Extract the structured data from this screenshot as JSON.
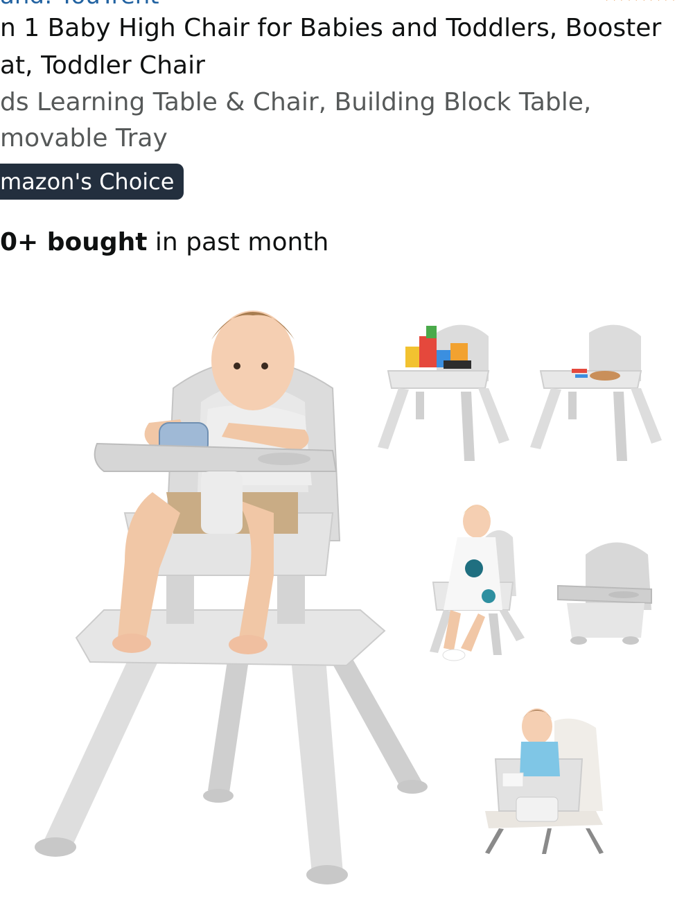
{
  "product": {
    "brand_partial": "and: YouTrent",
    "rating_stars_partial": "★★★★★",
    "title": "n 1 Baby High Chair for Babies and Toddlers, Booster at, Toddler Chair",
    "subtitle": "ds Learning Table & Chair, Building Block Table, movable Tray",
    "badge": "mazon's Choice",
    "bought_count": "0+ bought",
    "bought_suffix": " in past month"
  },
  "image": {
    "icon": "product-photo-high-chair",
    "colors": {
      "chair_gray": "#d9d9d9",
      "chair_dark": "#bdbdbd",
      "badge_bg": "#232f3e"
    }
  }
}
